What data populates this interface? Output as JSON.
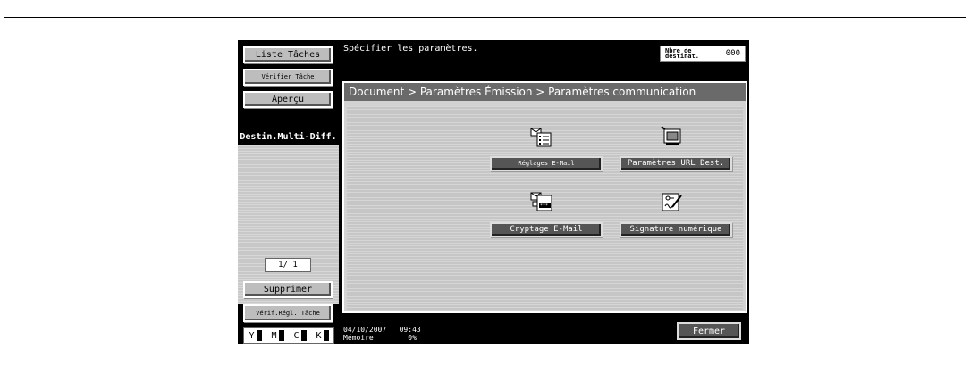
{
  "left_panel": {
    "job_list_label": "Liste Tâches",
    "verify_job_label": "Vérifier Tâche",
    "preview_label": "Aperçu",
    "multi_dest_label": "Destin.Multi-Diff.",
    "page_indicator": "1/  1",
    "delete_label": "Supprimer",
    "verify_settings_label": "Vérif.Régl. Tâche",
    "toner": [
      "Y",
      "M",
      "C",
      "K"
    ]
  },
  "header": {
    "message": "Spécifier les paramètres.",
    "dest_count_label": "Nbre de destinat.",
    "dest_count_value": "000"
  },
  "breadcrumb": "Document > Paramètres Émission > Paramètres communication",
  "functions": {
    "email_settings": "Réglages E-Mail",
    "url_settings": "Paramètres URL Dest.",
    "email_encryption": "Cryptage E-Mail",
    "digital_signature": "Signature numérique"
  },
  "footer": {
    "datetime": "04/10/2007   09:43",
    "memory_label": "Mémoire",
    "memory_value": "0%",
    "close_label": "Fermer"
  }
}
